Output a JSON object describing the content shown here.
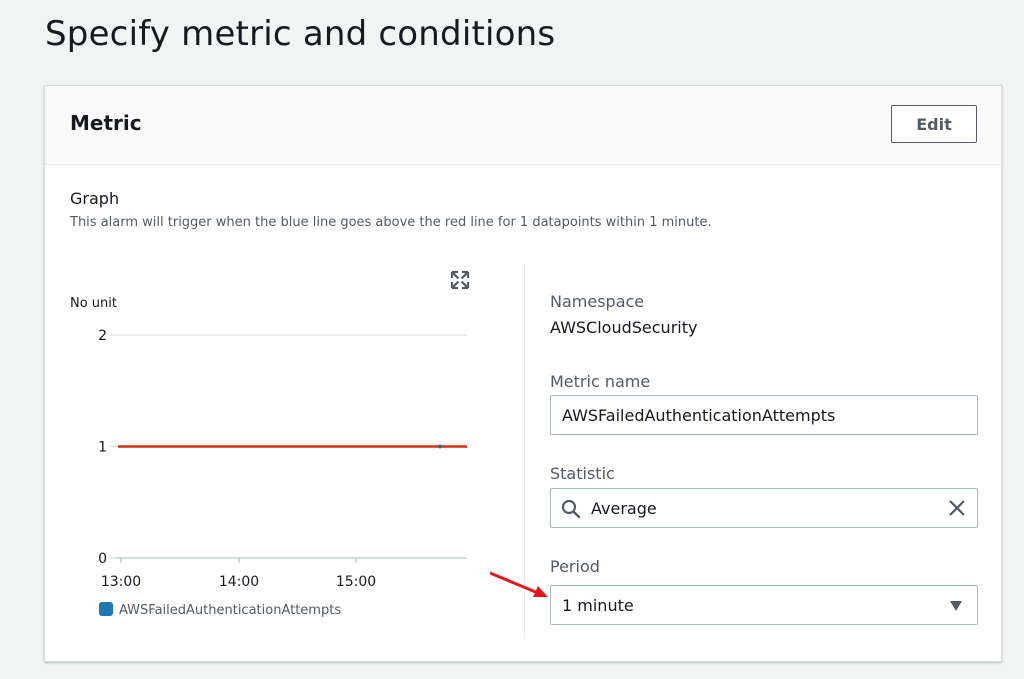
{
  "page": {
    "title": "Specify metric and conditions"
  },
  "metric_panel": {
    "title": "Metric",
    "edit_label": "Edit",
    "graph_heading": "Graph",
    "graph_description": "This alarm will trigger when the blue line goes above the red line for 1 datapoints within 1 minute."
  },
  "chart_data": {
    "type": "line",
    "ylabel": "No unit",
    "ylim": [
      0,
      2
    ],
    "yticks": [
      "2",
      "1",
      "0"
    ],
    "xticks": [
      "13:00",
      "14:00",
      "15:00"
    ],
    "series": [
      {
        "name": "AWSFailedAuthenticationAttempts",
        "color": "#1f77b4",
        "values": []
      }
    ],
    "threshold": {
      "value": 1,
      "color": "#d13212"
    },
    "grid": true,
    "legend": "bottom-left"
  },
  "details": {
    "namespace_label": "Namespace",
    "namespace_value": "AWSCloudSecurity",
    "metric_name_label": "Metric name",
    "metric_name_value": "AWSFailedAuthenticationAttempts",
    "statistic_label": "Statistic",
    "statistic_value": "Average",
    "period_label": "Period",
    "period_value": "1 minute"
  },
  "colors": {
    "accent": "#d13212",
    "series": "#1f77b4",
    "annotation_arrow": "#e0191c"
  },
  "icons": {
    "expand": "expand-icon",
    "search": "search-icon",
    "clear": "close-icon",
    "caret": "caret-down-icon"
  }
}
